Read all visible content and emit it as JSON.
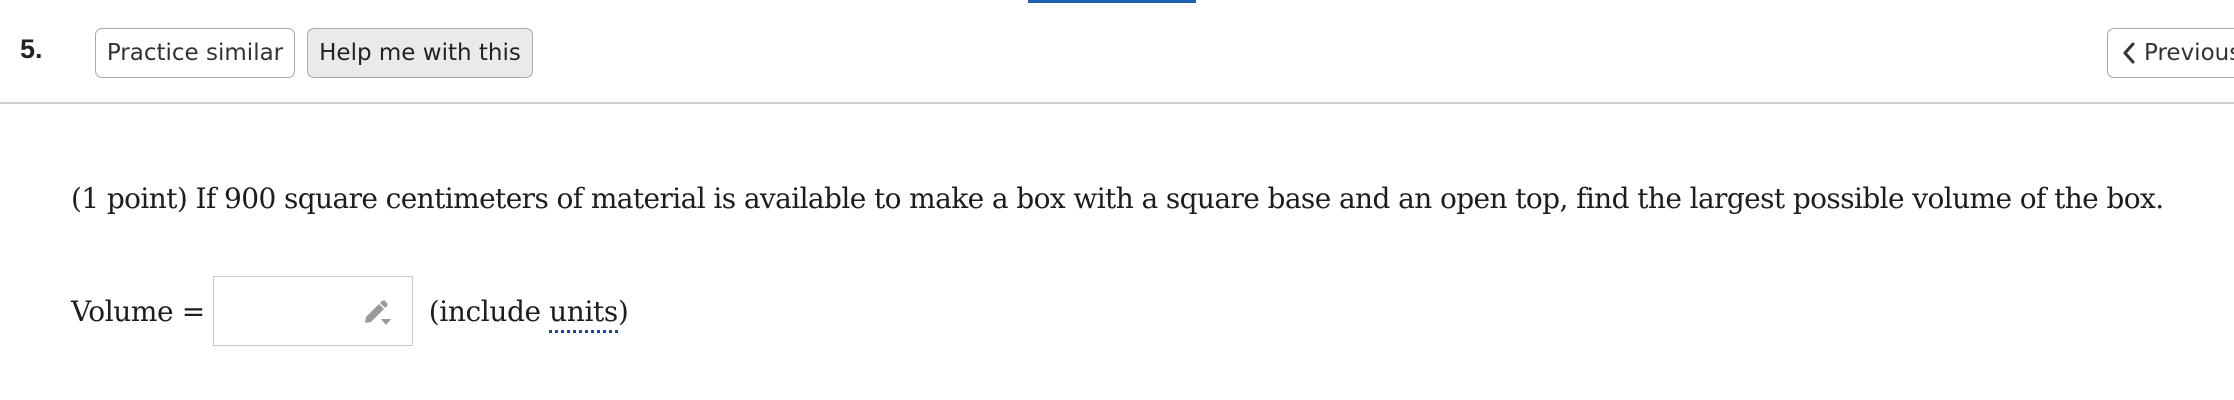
{
  "header": {
    "problem_number": "5.",
    "practice_label": "Practice similar",
    "help_label": "Help me with this",
    "previous_label": "Previous"
  },
  "problem": {
    "text": "(1 point) If 900 square centimeters of material is available to make a box with a square base and an open top, find the largest possible volume of the box.",
    "answer_label": "Volume =",
    "answer_value": "",
    "units_prefix": "(include ",
    "units_word": "units",
    "units_suffix": ")"
  },
  "icons": {
    "previous": "chevron-left-icon",
    "answer_tool": "pencil-icon"
  },
  "colors": {
    "accent": "#1f5fae",
    "units_underline": "#1a3fae",
    "button_border": "#a9a9a9",
    "help_button_bg": "#eaeaea"
  }
}
